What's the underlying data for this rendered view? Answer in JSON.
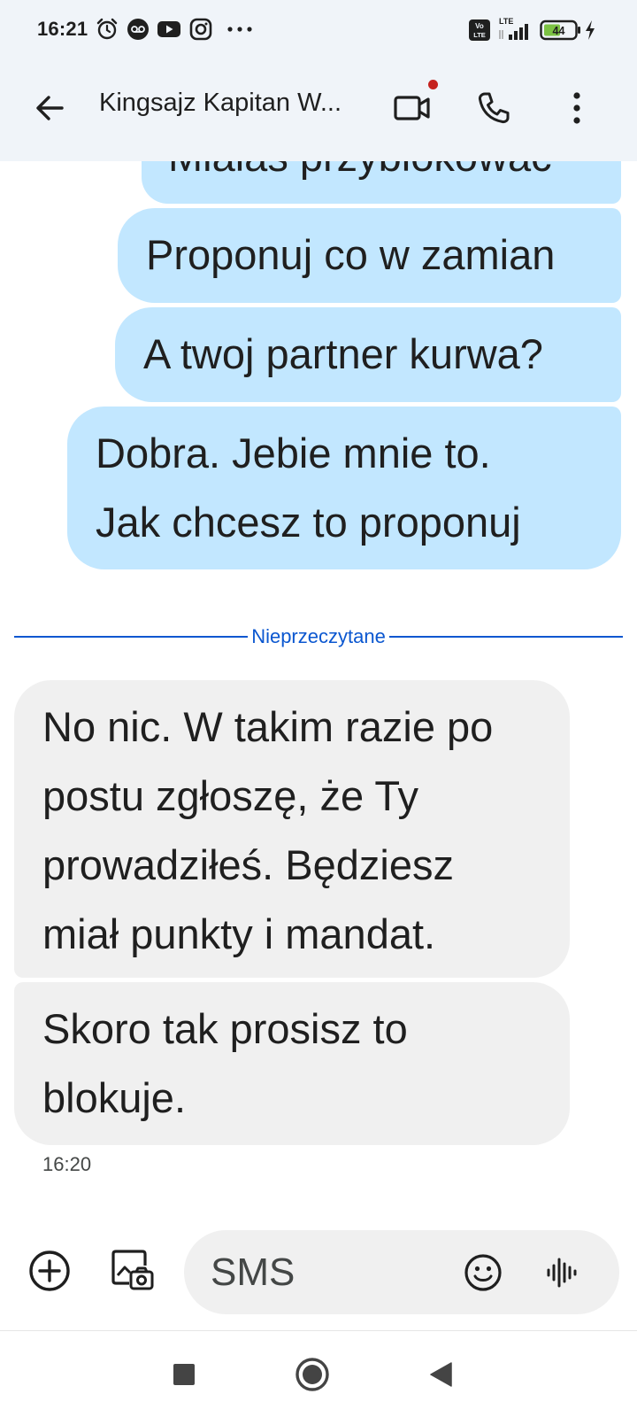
{
  "status_bar": {
    "time": "16:21",
    "left_icons": [
      "alarm-icon",
      "voicemail-icon",
      "youtube-icon",
      "instagram-icon",
      "more-notifications-icon"
    ],
    "right_icons": [
      "volte-icon",
      "lte-signal-icon",
      "battery-icon",
      "charging-icon"
    ],
    "lte_label": "LTE",
    "volte_label": "Vo LTE",
    "battery_level": "44"
  },
  "app_bar": {
    "title": "Kingsajz Kapitan W...",
    "video_call_has_badge": true,
    "badge_color": "#c5221f"
  },
  "messages": {
    "outgoing": [
      {
        "text": "Miałaś przyblokować"
      },
      {
        "text": "Proponuj co w zamian"
      },
      {
        "text": "A twoj partner kurwa?"
      },
      {
        "lines": [
          "Dobra. Jebie mnie to.",
          "Jak chcesz to proponuj"
        ]
      }
    ],
    "unread_divider": "Nieprzeczytane",
    "incoming": [
      {
        "lines": [
          "No nic. W takim razie po",
          "postu zgłoszę, że Ty",
          "prowadziłeś. Będziesz",
          "miał punkty i mandat."
        ]
      },
      {
        "lines": [
          "Skoro tak prosisz to",
          "blokuje."
        ]
      }
    ],
    "timestamp": "16:20"
  },
  "compose": {
    "placeholder": "SMS"
  },
  "colors": {
    "header_bg": "#f0f4f9",
    "outgoing_bubble": "#c2e7ff",
    "incoming_bubble": "#f0f0f0",
    "accent": "#0b57d0"
  }
}
